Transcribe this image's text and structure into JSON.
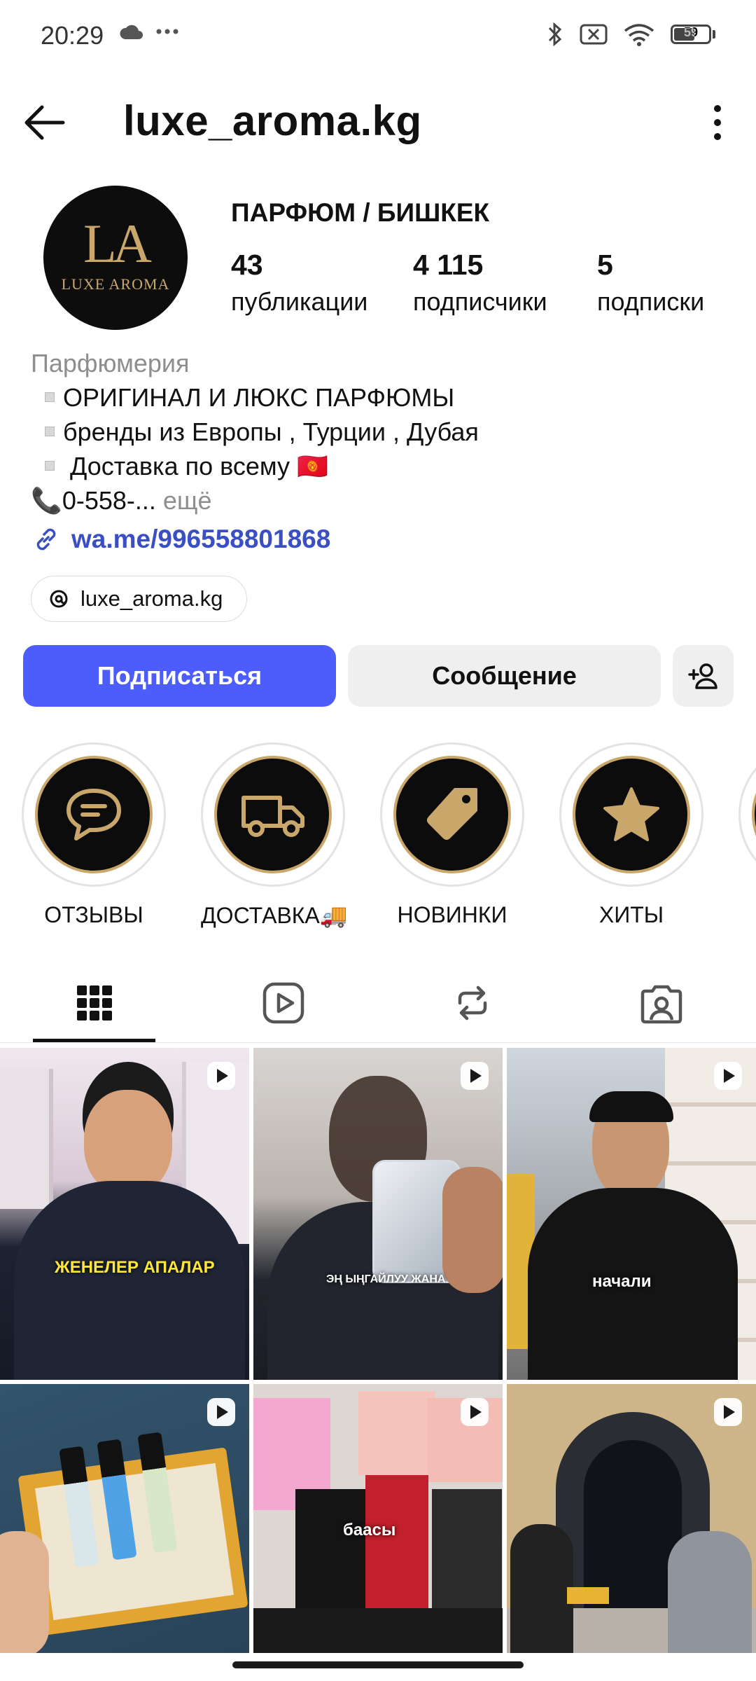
{
  "status_bar": {
    "time": "20:29",
    "battery": "59"
  },
  "header": {
    "username": "luxe_aroma.kg"
  },
  "profile": {
    "avatar_logo_initials": "LA",
    "avatar_logo_text": "LUXE AROMA",
    "category_title": "ПАРФЮМ / БИШКЕК",
    "stats": [
      {
        "value": "43",
        "label": "публикации"
      },
      {
        "value": "4 115",
        "label": "подписчики"
      },
      {
        "value": "5",
        "label": "подписки"
      }
    ],
    "bio": {
      "category": "Парфюмерия",
      "lines": [
        "ОРИГИНАЛ И ЛЮКС ПАРФЮМЫ",
        "бренды из Европы , Турции , Дубая",
        " Доставка по всему 🇰🇬"
      ],
      "phone": "📞0-558-...",
      "more": " ещё"
    },
    "link": "wa.me/996558801868",
    "threads_handle": "luxe_aroma.kg"
  },
  "actions": {
    "follow": "Подписаться",
    "message": "Сообщение"
  },
  "highlights": [
    {
      "label": "ОТЗЫВЫ",
      "icon": "chat-icon"
    },
    {
      "label": "ДОСТАВКА🚚",
      "icon": "truck-icon"
    },
    {
      "label": "НОВИНКИ",
      "icon": "tag-icon"
    },
    {
      "label": "ХИТЫ",
      "icon": "star-icon"
    }
  ],
  "tabs": [
    "grid-icon",
    "reels-icon",
    "reposts-icon",
    "tagged-icon"
  ],
  "grid": [
    {
      "caption": "ЖЕНЕЛЕР АПАЛАР"
    },
    {
      "caption": "ЭҢ ЫҢГАЙЛУУ ЖАНА"
    },
    {
      "caption": "начали"
    },
    {
      "caption": ""
    },
    {
      "caption": "баасы"
    },
    {
      "caption": ""
    }
  ],
  "colors": {
    "accent": "#4c5dfb",
    "link": "#3a4fc4",
    "gold": "#c9a76b"
  }
}
